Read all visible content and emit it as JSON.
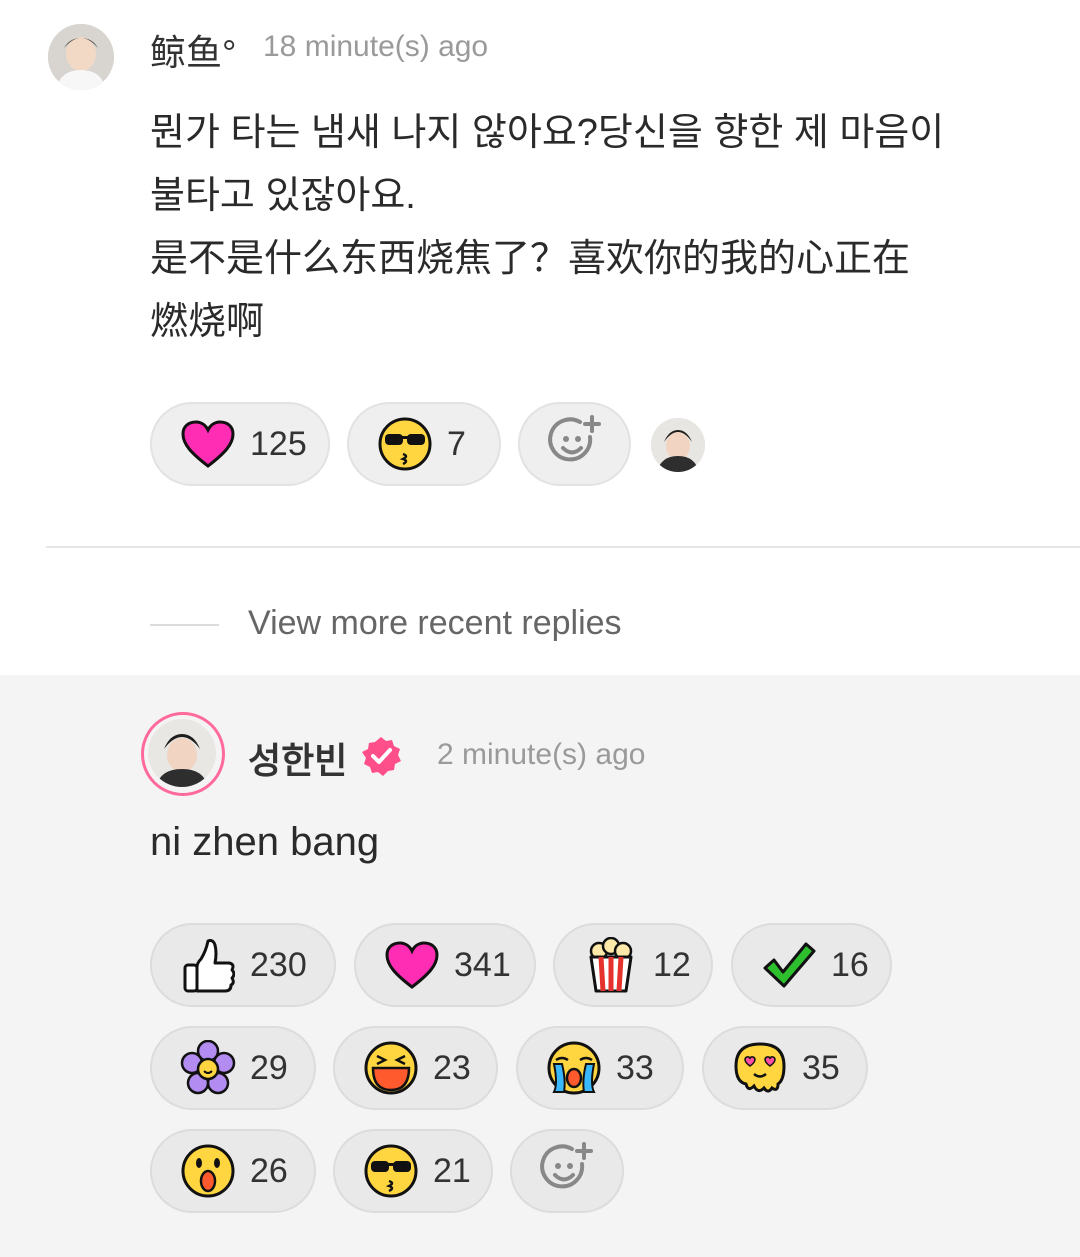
{
  "comment": {
    "username": "鲸鱼°",
    "time": "18 minute(s) ago",
    "body_lines": [
      "뭔가 타는 냄새 나지 않아요?당신을 향한 제 마음이",
      "불타고 있잖아요.",
      "是不是什么东西烧焦了？喜欢你的我的心正在",
      "燃烧啊"
    ],
    "reactions": [
      {
        "icon": "heart-icon",
        "count": "125"
      },
      {
        "icon": "sunglasses-kiss-icon",
        "count": "7"
      }
    ]
  },
  "view_more": "View more recent replies",
  "reply": {
    "username": "성한빈",
    "time": "2 minute(s) ago",
    "body": "ni zhen bang",
    "reactions": [
      {
        "icon": "thumbs-up-icon",
        "count": "230"
      },
      {
        "icon": "heart-icon",
        "count": "341"
      },
      {
        "icon": "popcorn-icon",
        "count": "12"
      },
      {
        "icon": "checkmark-icon",
        "count": "16"
      },
      {
        "icon": "flower-icon",
        "count": "29"
      },
      {
        "icon": "laughing-face-icon",
        "count": "23"
      },
      {
        "icon": "crying-face-icon",
        "count": "33"
      },
      {
        "icon": "heart-eyes-melting-icon",
        "count": "35"
      },
      {
        "icon": "surprised-face-icon",
        "count": "26"
      },
      {
        "icon": "sunglasses-kiss-icon",
        "count": "21"
      }
    ]
  },
  "colors": {
    "heart": "#ff2db4",
    "verified": "#ff4f8a",
    "reply_bg": "#f4f4f4",
    "pill_bg": "#efefef"
  }
}
